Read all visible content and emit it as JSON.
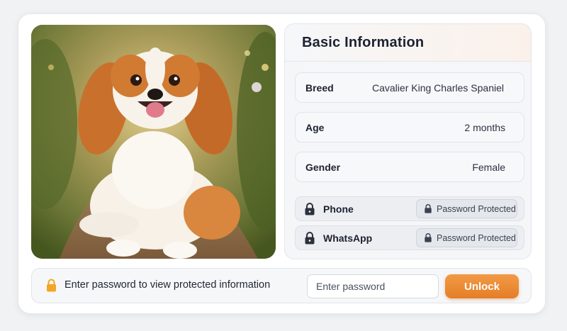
{
  "basic_info": {
    "title": "Basic Information",
    "breed": {
      "label": "Breed",
      "value": "Cavalier King Charles Spaniel"
    },
    "age": {
      "label": "Age",
      "value": "2 months"
    },
    "gender": {
      "label": "Gender",
      "value": "Female"
    }
  },
  "protected": {
    "phone": {
      "label": "Phone",
      "status": "Password Protected"
    },
    "whatsapp": {
      "label": "WhatsApp",
      "status": "Password Protected"
    }
  },
  "unlock": {
    "message": "Enter password to view protected information",
    "placeholder": "Enter password",
    "button_label": "Unlock"
  },
  "icons": {
    "lock": "lock-icon",
    "gold_lock": "lock-icon-gold"
  },
  "colors": {
    "accent": "#e8842e",
    "lock_gold": "#f2a623",
    "lock_dark": "#2b313c"
  }
}
